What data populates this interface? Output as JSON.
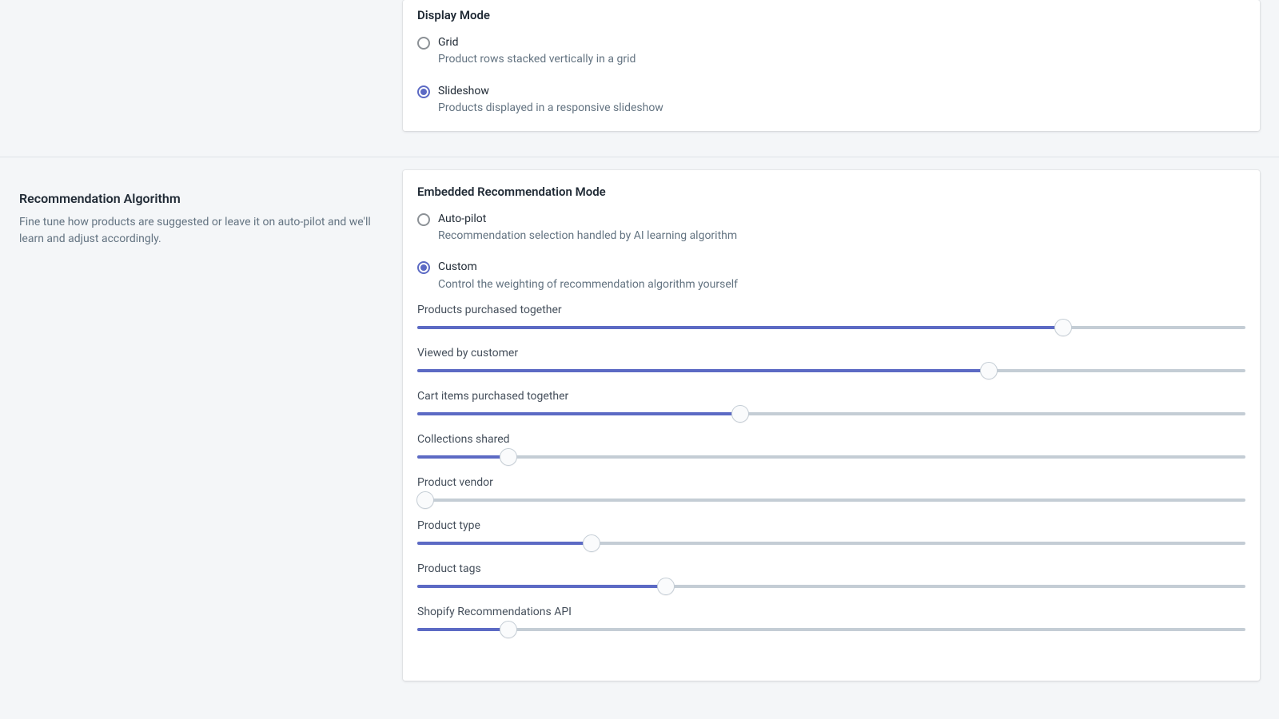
{
  "display_mode": {
    "title": "Display Mode",
    "options": [
      {
        "label": "Grid",
        "desc": "Product rows stacked vertically in a grid",
        "selected": false
      },
      {
        "label": "Slideshow",
        "desc": "Products displayed in a responsive slideshow",
        "selected": true
      }
    ]
  },
  "algorithm_section": {
    "title": "Recommendation Algorithm",
    "desc": "Fine tune how products are suggested or leave it on auto-pilot and we'll learn and adjust accordingly."
  },
  "embedded_mode": {
    "title": "Embedded Recommendation Mode",
    "options": [
      {
        "label": "Auto-pilot",
        "desc": "Recommendation selection handled by AI learning algorithm",
        "selected": false
      },
      {
        "label": "Custom",
        "desc": "Control the weighting of recommendation algorithm yourself",
        "selected": true
      }
    ]
  },
  "sliders": [
    {
      "label": "Products purchased together",
      "value": 78
    },
    {
      "label": "Viewed by customer",
      "value": 69
    },
    {
      "label": "Cart items purchased together",
      "value": 39
    },
    {
      "label": "Collections shared",
      "value": 11
    },
    {
      "label": "Product vendor",
      "value": 1
    },
    {
      "label": "Product type",
      "value": 21
    },
    {
      "label": "Product tags",
      "value": 30
    },
    {
      "label": "Shopify Recommendations API",
      "value": 11
    }
  ],
  "colors": {
    "accent": "#5c6ac4",
    "track": "#c4cdd5",
    "text_muted": "#637381"
  }
}
